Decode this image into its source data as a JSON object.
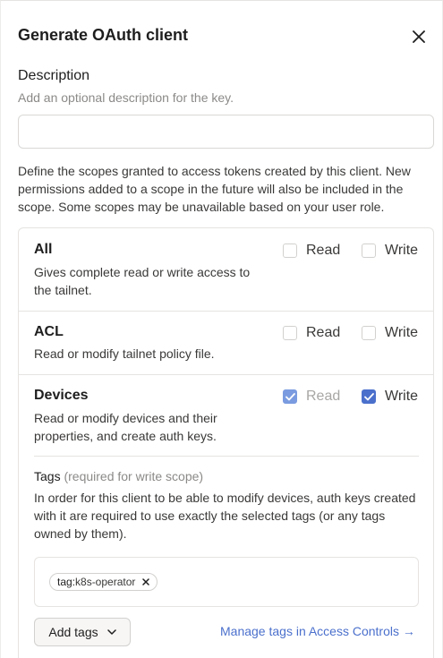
{
  "dialog": {
    "title": "Generate OAuth client",
    "close_icon": "close-icon"
  },
  "description": {
    "label": "Description",
    "hint": "Add an optional description for the key.",
    "value": "",
    "placeholder": ""
  },
  "scopes_intro": "Define the scopes granted to access tokens created by this client. New permissions added to a scope in the future will also be included in the scope. Some scopes may be unavailable based on your user role.",
  "scopes": [
    {
      "name": "All",
      "description": "Gives complete read or write access to the tailnet.",
      "read": {
        "label": "Read",
        "checked": false,
        "disabled": false
      },
      "write": {
        "label": "Write",
        "checked": false,
        "disabled": false
      }
    },
    {
      "name": "ACL",
      "description": "Read or modify tailnet policy file.",
      "read": {
        "label": "Read",
        "checked": false,
        "disabled": false
      },
      "write": {
        "label": "Write",
        "checked": false,
        "disabled": false
      }
    },
    {
      "name": "Devices",
      "description": "Read or modify devices and their properties, and create auth keys.",
      "read": {
        "label": "Read",
        "checked": true,
        "disabled": true
      },
      "write": {
        "label": "Write",
        "checked": true,
        "disabled": false
      }
    }
  ],
  "tags": {
    "heading": "Tags",
    "heading_note": "(required for write scope)",
    "description": "In order for this client to be able to modify devices, auth keys created with it are required to use exactly the selected tags (or any tags owned by them).",
    "selected": [
      {
        "prefix": "tag:",
        "value": "k8s-operator"
      }
    ],
    "add_button_label": "Add tags",
    "manage_link": "Manage tags in Access Controls →"
  },
  "colors": {
    "accent": "#4b70cc",
    "accent_disabled": "#7a9be0",
    "border": "#e5e4e2"
  }
}
